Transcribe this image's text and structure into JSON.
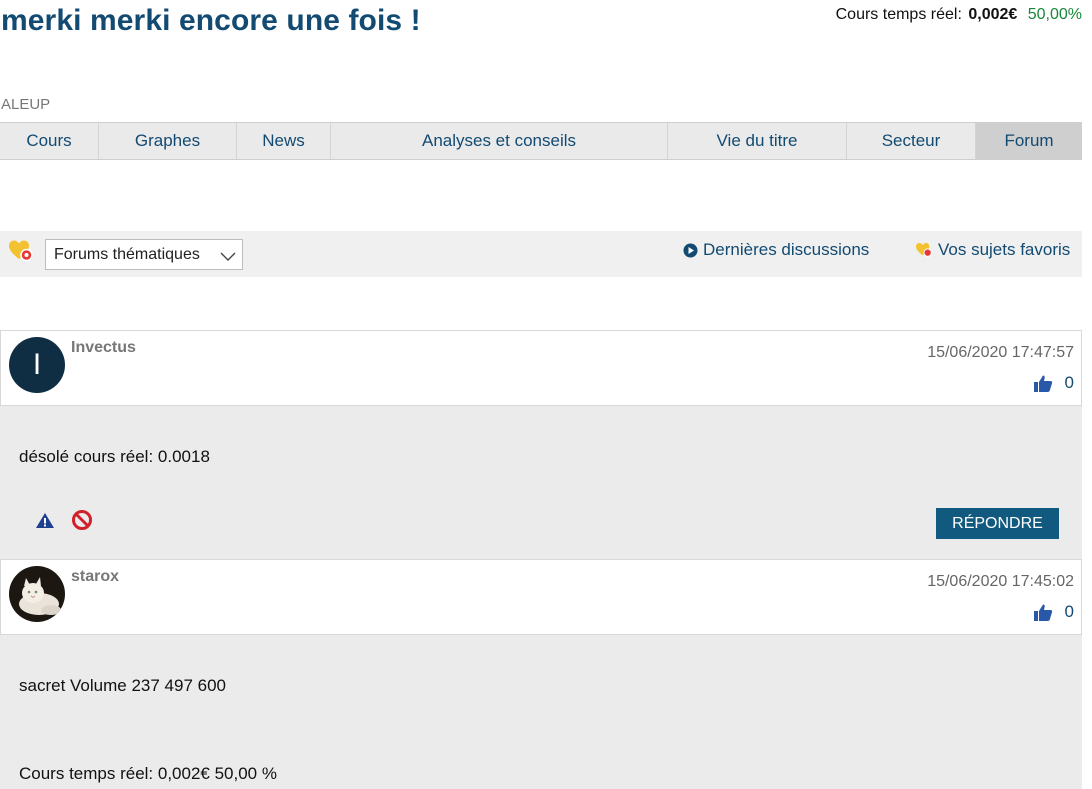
{
  "header": {
    "title": "merki merki encore une fois !",
    "quote_label": "Cours temps réel:",
    "quote_price": "0,002€",
    "quote_change": "50,00%",
    "change_color": "#17883a"
  },
  "ticker": "ALEUP",
  "nav": {
    "tabs": [
      {
        "label": "Cours"
      },
      {
        "label": "Graphes"
      },
      {
        "label": "News"
      },
      {
        "label": "Analyses et conseils"
      },
      {
        "label": "Vie du titre"
      },
      {
        "label": "Secteur"
      },
      {
        "label": "Forum",
        "active": true
      }
    ]
  },
  "forumbar": {
    "select_value": "Forums thématiques",
    "latest_label": "Dernières discussions",
    "favorites_label": "Vos sujets favoris"
  },
  "posts": [
    {
      "author": "Invectus",
      "avatar_letter": "I",
      "date": "15/06/2020 17:47:57",
      "likes": "0",
      "text": "désolé cours réel: 0.0018",
      "reply_label": "RÉPONDRE"
    },
    {
      "author": "starox",
      "date": "15/06/2020 17:45:02",
      "likes": "0",
      "lines": [
        "sacret Volume 237 497 600",
        "Cours temps réel: 0,002€ 50,00 %"
      ]
    }
  ],
  "colors": {
    "brand": "#124a72",
    "button": "#12597f",
    "warning_icon": "#1c3f8f",
    "block_icon": "#d0202a",
    "favorite_icon": "#f2c230"
  },
  "icons": {
    "favorite": "heart-favorite-icon",
    "chevron": "chevron-down-icon",
    "play": "play-circle-icon",
    "like": "thumbs-up-icon",
    "warn": "warning-icon",
    "block": "block-icon"
  }
}
